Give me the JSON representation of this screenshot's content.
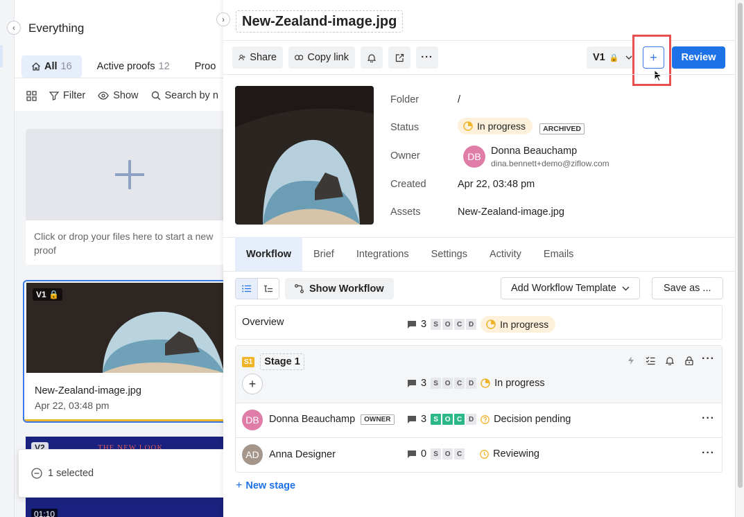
{
  "left": {
    "title": "Everything",
    "tabs": [
      {
        "label": "All",
        "count": "16"
      },
      {
        "label": "Active proofs",
        "count": "12"
      },
      {
        "label": "Proo",
        "count": ""
      }
    ],
    "toolbar": {
      "filter": "Filter",
      "show": "Show",
      "search": "Search by n"
    },
    "dropzone_hint": "Click or drop your files here to start a new proof",
    "card": {
      "version": "V1",
      "name": "New-Zealand-image.jpg",
      "date": "Apr 22, 03:48 pm"
    },
    "card2": {
      "version": "V2",
      "overlay_text": "THE NEW LOOK",
      "time": "01:10"
    },
    "selection": "1 selected"
  },
  "panel": {
    "title": "New-Zealand-image.jpg",
    "toolbar": {
      "share": "Share",
      "copy_link": "Copy link",
      "version": "V1",
      "review": "Review"
    },
    "meta": {
      "folder_label": "Folder",
      "folder_value": "/",
      "status_label": "Status",
      "status_value": "In progress",
      "archived": "ARCHIVED",
      "owner_label": "Owner",
      "owner_initials": "DB",
      "owner_name": "Donna Beauchamp",
      "owner_email": "dina.bennett+demo@ziflow.com",
      "created_label": "Created",
      "created_value": "Apr 22, 03:48 pm",
      "assets_label": "Assets",
      "assets_value": "New-Zealand-image.jpg"
    },
    "tabs": [
      "Workflow",
      "Brief",
      "Integrations",
      "Settings",
      "Activity",
      "Emails"
    ],
    "workflow": {
      "show_workflow": "Show Workflow",
      "add_template": "Add Workflow Template",
      "save_as": "Save as ...",
      "overview": {
        "label": "Overview",
        "comments": "3",
        "chips": [
          "S",
          "O",
          "C",
          "D"
        ],
        "status": "In progress"
      },
      "stage": {
        "badge": "S1",
        "name": "Stage 1",
        "comments": "3",
        "chips": [
          "S",
          "O",
          "C",
          "D"
        ],
        "status": "In progress"
      },
      "reviewers": [
        {
          "initials": "DB",
          "name": "Donna Beauchamp",
          "badge": "OWNER",
          "comments": "3",
          "chips": [
            "S",
            "O",
            "C",
            "D"
          ],
          "status": "Decision pending"
        },
        {
          "initials": "AD",
          "name": "Anna Designer",
          "badge": "",
          "comments": "0",
          "chips": [
            "S",
            "O",
            "C"
          ],
          "status": "Reviewing"
        }
      ],
      "new_stage": "New stage"
    }
  },
  "colors": {
    "accent": "#1d72e8",
    "highlight": "#e8504f",
    "progress": "#f0b429",
    "approved": "#2eb88a"
  },
  "icons": [
    "chevron-left-icon",
    "home-icon",
    "grid-icon",
    "filter-icon",
    "eye-icon",
    "search-icon",
    "plus-icon",
    "lock-icon",
    "share-icon",
    "link-icon",
    "bell-icon",
    "external-icon",
    "more-icon",
    "chevron-down-icon",
    "cursor-icon",
    "list-icon",
    "tree-icon",
    "workflow-icon",
    "comment-icon",
    "progress-icon",
    "question-icon",
    "clock-icon",
    "bolt-icon",
    "checklist-icon",
    "minus-circle-icon"
  ]
}
